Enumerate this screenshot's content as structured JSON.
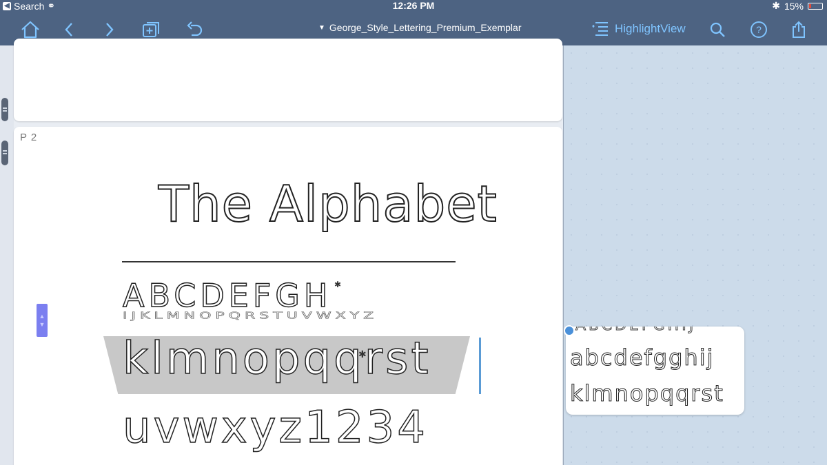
{
  "statusbar": {
    "back_label": "Search",
    "time": "12:26 PM",
    "battery": "15%",
    "battery_level": 0.15
  },
  "toolbar": {
    "document_title": "George_Style_Lettering_Premium_Exemplar",
    "highlight_view_label": "HighlightView"
  },
  "page": {
    "label": "P 2",
    "title": "The Alphabet",
    "uppercase_row": "ABCDEFGH",
    "garbled_row": "IJKLMNOPQRSTUVWXYZ",
    "lowercase_row_1": "klmnopqqrst",
    "lowercase_row_2": "uvwxyz1234"
  },
  "snippet": {
    "top_row": "ABCDEFGHIJ",
    "row_1": "abcdefgghij",
    "row_2": "klmnopqqrst"
  },
  "colors": {
    "toolbar_bg": "#4d6382",
    "accent": "#7fc4ff",
    "highlight_band": "#c8c8c8",
    "cursor": "#5a9bd5",
    "scroll_marker": "#7b7ff0"
  }
}
